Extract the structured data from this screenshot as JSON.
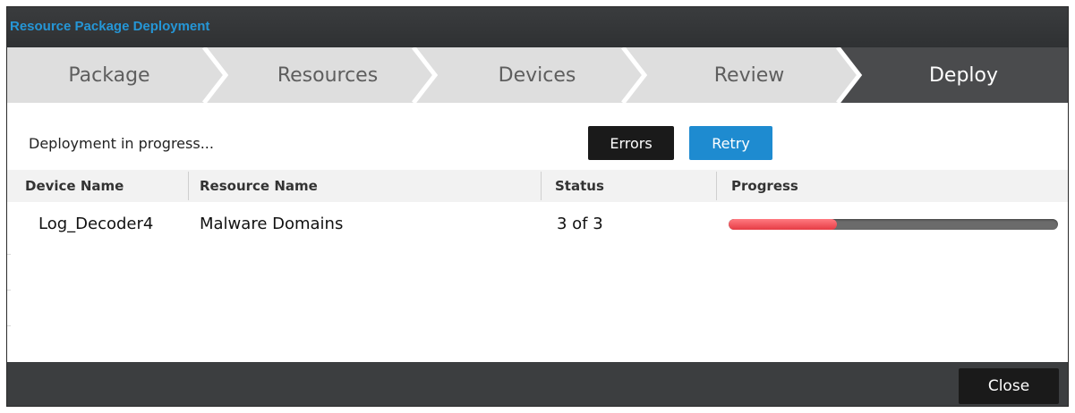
{
  "dialog": {
    "title": "Resource Package Deployment"
  },
  "wizard": {
    "steps": [
      {
        "label": "Package",
        "active": false
      },
      {
        "label": "Resources",
        "active": false
      },
      {
        "label": "Devices",
        "active": false
      },
      {
        "label": "Review",
        "active": false
      },
      {
        "label": "Deploy",
        "active": true
      }
    ],
    "colors": {
      "inactive_bg": "#dedede",
      "active_bg": "#4a4b4d"
    }
  },
  "status": {
    "message": "Deployment in progress..."
  },
  "buttons": {
    "errors_label": "Errors",
    "retry_label": "Retry",
    "close_label": "Close"
  },
  "table": {
    "columns": [
      "Device Name",
      "Resource Name",
      "Status",
      "Progress"
    ],
    "rows": [
      {
        "device_name": "Log_Decoder4",
        "resource_name": "Malware Domains",
        "status": "3 of 3",
        "progress": 0.33
      }
    ]
  },
  "colors": {
    "title_accent": "#2596d6",
    "retry_button": "#1e8bd0",
    "dark_button": "#1a1a1a",
    "progress_fill": "#e63c45",
    "progress_track": "#6b6b6b"
  }
}
